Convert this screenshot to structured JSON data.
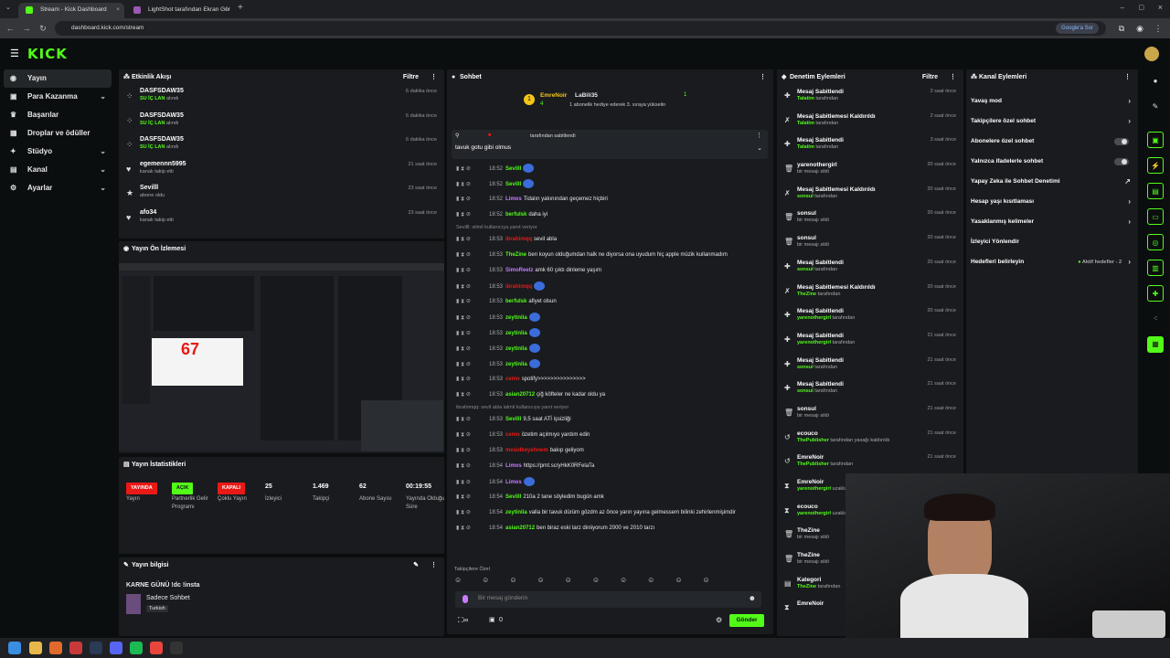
{
  "browser": {
    "tabs": [
      {
        "title": "Stream - Kick Dashboard",
        "active": true
      },
      {
        "title": "LightShot tarafından Ekran Gör",
        "active": false
      }
    ],
    "url": "dashboard.kick.com/stream",
    "google_chip": "Google'a Sor"
  },
  "app": {
    "logo": "KICK"
  },
  "sidebar": {
    "items": [
      {
        "label": "Yayın",
        "icon": "broadcast-icon",
        "chevron": false
      },
      {
        "label": "Para Kazanma",
        "icon": "money-icon",
        "chevron": true
      },
      {
        "label": "Başarılar",
        "icon": "trophy-icon",
        "chevron": false
      },
      {
        "label": "Droplar ve ödüller",
        "icon": "gift-icon",
        "chevron": false
      },
      {
        "label": "Stüdyo",
        "icon": "studio-icon",
        "chevron": true
      },
      {
        "label": "Kanal",
        "icon": "channel-icon",
        "chevron": true
      },
      {
        "label": "Ayarlar",
        "icon": "settings-icon",
        "chevron": true
      }
    ]
  },
  "activity": {
    "title": "Etkinlik Akışı",
    "filter": "Filtre",
    "items": [
      {
        "name": "DASFSDAW35",
        "prefix": "SU İÇ LAN",
        "sub": "alındı",
        "time": "6 dakika önce",
        "icon": "reward-icon"
      },
      {
        "name": "DASFSDAW35",
        "prefix": "SU İÇ LAN",
        "sub": "alındı",
        "time": "6 dakika önce",
        "icon": "reward-icon"
      },
      {
        "name": "DASFSDAW35",
        "prefix": "SU İÇ LAN",
        "sub": "alındı",
        "time": "6 dakika önce",
        "icon": "reward-icon"
      },
      {
        "name": "egemennn5995",
        "prefix": "",
        "sub": "kanalı takip etti",
        "time": "21 saat önce",
        "icon": "heart-icon"
      },
      {
        "name": "Sevilll",
        "prefix": "",
        "sub": "abone oldu",
        "time": "23 saat önce",
        "icon": "star-icon"
      },
      {
        "name": "afo34",
        "prefix": "",
        "sub": "kanalı takip etti",
        "time": "23 saat önce",
        "icon": "heart-icon"
      }
    ]
  },
  "preview": {
    "title": "Yayın Ön İzlemesi",
    "overlay_number": "67"
  },
  "stats": {
    "title": "Yayın İstatistikleri",
    "columns": [
      {
        "badge": "YAYINDA",
        "badge_color": "#e91916",
        "label": "Yayın"
      },
      {
        "badge": "AÇIK",
        "badge_color": "#53fc18",
        "label": "Partnerlik Gelir Programı"
      },
      {
        "badge": "KAPALI",
        "badge_color": "#e91916",
        "label": "Çoklu Yayın"
      },
      {
        "value": "25",
        "label": "İzleyici"
      },
      {
        "value": "1.469",
        "label": "Takipçi"
      },
      {
        "value": "62",
        "label": "Abone Sayısı"
      },
      {
        "value": "00:19:55",
        "label": "Yayında Olduğu Süre"
      }
    ]
  },
  "stream_info": {
    "title": "Yayın bilgisi",
    "stream_title": "KARNE GÜNÜ !dc !insta",
    "tag1": "Sadece Sohbet",
    "tag2": "Turkish"
  },
  "chat": {
    "title": "Sohbet",
    "top_gifters": {
      "first": "EmreNoir",
      "first_count": "4",
      "second": "LaBili35",
      "second_count": "1",
      "banner": "1 abonelik hediye ederek 3. sıraya yükselin"
    },
    "pinned": {
      "by": "tarafından sabitlendi",
      "text": "tavuk gotu gibi olmus"
    },
    "messages": [
      {
        "time": "18:52",
        "user": "Sevilll",
        "color": "#53fc18",
        "text": ""
      },
      {
        "time": "18:52",
        "user": "Sevilll",
        "color": "#53fc18",
        "text": ""
      },
      {
        "time": "18:52",
        "user": "Limos",
        "color": "#c77dff",
        "text": "Tidalın yakınından geçemez hiçbiri"
      },
      {
        "time": "18:52",
        "user": "berfulsk",
        "color": "#53fc18",
        "text": "daha iyi"
      },
      {
        "reply": "Sevilll: silmil kullanıcıya yanıt veriyor"
      },
      {
        "time": "18:53",
        "user": "ibrahimqq",
        "color": "#e91916",
        "text": "sevil abla"
      },
      {
        "time": "18:53",
        "user": "TheZine",
        "color": "#53fc18",
        "text": "ben koyun olduğumdan halk ne diyorsa ona uyudum hiç apple müzik kullanmadım"
      },
      {
        "time": "18:53",
        "user": "SimoReelz",
        "color": "#c77dff",
        "text": "amk 60 çıktı dinleme yaşım"
      },
      {
        "time": "18:53",
        "user": "ibrahimqq",
        "color": "#e91916",
        "text": ""
      },
      {
        "time": "18:53",
        "user": "berfulsk",
        "color": "#53fc18",
        "text": "afiyet olsun"
      },
      {
        "time": "18:53",
        "user": "zeytinlia",
        "color": "#53fc18",
        "text": ""
      },
      {
        "time": "18:53",
        "user": "zeytinlia",
        "color": "#53fc18",
        "text": ""
      },
      {
        "time": "18:53",
        "user": "zeytinlia",
        "color": "#53fc18",
        "text": ""
      },
      {
        "time": "18:53",
        "user": "zeytinlia",
        "color": "#53fc18",
        "text": ""
      },
      {
        "time": "18:53",
        "user": "cemo",
        "color": "#e91916",
        "text": "spotify>>>>>>>>>>>>>>>"
      },
      {
        "time": "18:53",
        "user": "asian20712",
        "color": "#53fc18",
        "text": "çiğ köfteler ne kadar oldu ya"
      },
      {
        "reply": "ibrahimqq: sevil abla lalmil kullanıcıya yanıt veriyor"
      },
      {
        "time": "18:53",
        "user": "Sevilll",
        "color": "#53fc18",
        "text": "9,5 saat ATİ işsizliği"
      },
      {
        "time": "18:53",
        "user": "cemo",
        "color": "#e91916",
        "text": "özetim açılmıyo yardım edin"
      },
      {
        "time": "18:53",
        "user": "mesidkeyehnem",
        "color": "#e91916",
        "text": "bakıp geliyom"
      },
      {
        "time": "18:54",
        "user": "Limos",
        "color": "#c77dff",
        "text": "https://prnt.sc/yHkK0RFelaTa"
      },
      {
        "time": "18:54",
        "user": "Limos",
        "color": "#c77dff",
        "text": ""
      },
      {
        "time": "18:54",
        "user": "Sevilll",
        "color": "#53fc18",
        "text": "210a 2 tane söyledim bugün amk"
      },
      {
        "time": "18:54",
        "user": "zeytinlia",
        "color": "#53fc18",
        "text": "valla bir tavuk dürüm gözdm az önce yarın yayına gelmessem bilinki zehirlenmişimdir"
      },
      {
        "time": "18:54",
        "user": "asian20712",
        "color": "#53fc18",
        "text": "ben biraz eski tarz diniiyorum 2000 ve 2010 tarzı"
      }
    ],
    "followers_only": "Takipçilere Özel",
    "input_placeholder": "Bir mesaj gönderin",
    "send": "Gönder",
    "counter": "0"
  },
  "moderation": {
    "title": "Denetim Eylemleri",
    "filter": "Filtre",
    "items": [
      {
        "action": "Mesaj Sabitlendi",
        "user": "Talatim",
        "suffix": "tarafından",
        "time": "2 saat önce",
        "icon": "pin-icon"
      },
      {
        "action": "Mesaj Sabitlemesi Kaldırıldı",
        "user": "Talatim",
        "suffix": "tarafından",
        "time": "2 saat önce",
        "icon": "unpin-icon"
      },
      {
        "action": "Mesaj Sabitlendi",
        "user": "Talatim",
        "suffix": "tarafından",
        "time": "3 saat önce",
        "icon": "pin-icon"
      },
      {
        "action": "yarenothergirl",
        "user": "",
        "suffix": "bir mesajı sildi",
        "time": "20 saat önce",
        "icon": "trash-icon"
      },
      {
        "action": "Mesaj Sabitlemesi Kaldırıldı",
        "user": "sonsul",
        "suffix": "tarafından",
        "time": "20 saat önce",
        "icon": "unpin-icon"
      },
      {
        "action": "sonsul",
        "user": "",
        "suffix": "bir mesajı sildi",
        "time": "20 saat önce",
        "icon": "trash-icon"
      },
      {
        "action": "sonsul",
        "user": "",
        "suffix": "bir mesajı sildi",
        "time": "20 saat önce",
        "icon": "trash-icon"
      },
      {
        "action": "Mesaj Sabitlendi",
        "user": "sonsul",
        "suffix": "tarafından",
        "time": "20 saat önce",
        "icon": "pin-icon"
      },
      {
        "action": "Mesaj Sabitlemesi Kaldırıldı",
        "user": "TheZine",
        "suffix": "tarafından",
        "time": "20 saat önce",
        "icon": "unpin-icon"
      },
      {
        "action": "Mesaj Sabitlendi",
        "user": "yarenothergirl",
        "suffix": "tarafından",
        "time": "20 saat önce",
        "icon": "pin-icon"
      },
      {
        "action": "Mesaj Sabitlendi",
        "user": "yarenothergirl",
        "suffix": "tarafından",
        "time": "21 saat önce",
        "icon": "pin-icon"
      },
      {
        "action": "Mesaj Sabitlendi",
        "user": "sonsul",
        "suffix": "tarafından",
        "time": "21 saat önce",
        "icon": "pin-icon"
      },
      {
        "action": "Mesaj Sabitlendi",
        "user": "sonsul",
        "suffix": "tarafından",
        "time": "21 saat önce",
        "icon": "pin-icon"
      },
      {
        "action": "sonsul",
        "user": "",
        "suffix": "bir mesajı sildi",
        "time": "21 saat önce",
        "icon": "trash-icon"
      },
      {
        "action": "ecouco",
        "user": "ThePublisher",
        "suffix": "tarafından yasağı kaldırıldı",
        "time": "21 saat önce",
        "icon": "undo-icon"
      },
      {
        "action": "EmreNoir",
        "user": "ThePublisher",
        "suffix": "tarafından",
        "time": "21 saat önce",
        "icon": "undo-icon"
      },
      {
        "action": "EmreNoir",
        "user": "yarenothergirl",
        "suffix": "uzaklaştırıldı",
        "time": "",
        "icon": "timeout-icon"
      },
      {
        "action": "ecouco",
        "user": "yarenothergirl",
        "suffix": "uzaklaştırıldı",
        "time": "",
        "icon": "timeout-icon"
      },
      {
        "action": "TheZine",
        "user": "",
        "suffix": "bir mesajı sildi",
        "time": "",
        "icon": "trash-icon"
      },
      {
        "action": "TheZine",
        "user": "",
        "suffix": "bir mesajı sildi",
        "time": "",
        "icon": "trash-icon"
      },
      {
        "action": "Kategori",
        "user": "TheZine",
        "suffix": "tarafından",
        "time": "",
        "icon": "category-icon"
      },
      {
        "action": "EmreNoir",
        "user": "",
        "suffix": "",
        "time": "",
        "icon": "timeout-icon"
      }
    ]
  },
  "channel_actions": {
    "title": "Kanal Eylemleri",
    "items": [
      {
        "label": "Yavaş mod",
        "kind": "arrow"
      },
      {
        "label": "Takipçilere özel sohbet",
        "kind": "arrow"
      },
      {
        "label": "Abonelere özel sohbet",
        "kind": "toggle"
      },
      {
        "label": "Yalnızca ifadelerle sohbet",
        "kind": "toggle"
      },
      {
        "label": "Yapay Zeka ile Sohbet Denetimi",
        "kind": "external"
      },
      {
        "label": "Hesap yaşı kısıtlaması",
        "kind": "arrow"
      },
      {
        "label": "Yasaklanmış kelimeler",
        "kind": "arrow"
      },
      {
        "label": "İzleyici Yönlendir",
        "kind": "none"
      },
      {
        "label": "Hedefleri belirleyin",
        "kind": "arrow",
        "extra": "Aktif hedefler - 2"
      }
    ]
  },
  "colors": {
    "accent": "#53fc18",
    "danger": "#e91916",
    "panel": "#191b1f",
    "bg": "#0b0e0f"
  }
}
